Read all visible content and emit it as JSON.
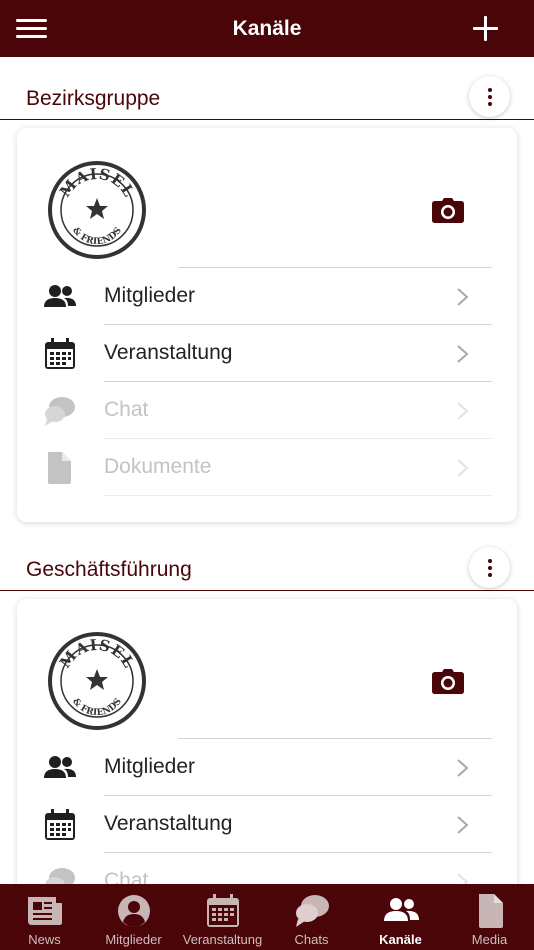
{
  "header": {
    "title": "Kanäle"
  },
  "sections": [
    {
      "title": "Bezirksgruppe",
      "logo_text": "MAISEL & FRIENDS",
      "items": [
        {
          "label": "Mitglieder",
          "icon": "users-icon",
          "enabled": true
        },
        {
          "label": "Veranstaltung",
          "icon": "calendar-icon",
          "enabled": true
        },
        {
          "label": "Chat",
          "icon": "chat-icon",
          "enabled": false
        },
        {
          "label": "Dokumente",
          "icon": "document-icon",
          "enabled": false
        }
      ]
    },
    {
      "title": "Geschäftsführung",
      "logo_text": "MAISEL & FRIENDS",
      "items": [
        {
          "label": "Mitglieder",
          "icon": "users-icon",
          "enabled": true
        },
        {
          "label": "Veranstaltung",
          "icon": "calendar-icon",
          "enabled": true
        },
        {
          "label": "Chat",
          "icon": "chat-icon",
          "enabled": false
        }
      ]
    }
  ],
  "tabbar": {
    "tabs": [
      {
        "label": "News",
        "icon": "news-icon",
        "active": false
      },
      {
        "label": "Mitglieder",
        "icon": "user-circle-icon",
        "active": false
      },
      {
        "label": "Veranstaltung",
        "icon": "calendar-icon",
        "active": false
      },
      {
        "label": "Chats",
        "icon": "chat-icon",
        "active": false
      },
      {
        "label": "Kanäle",
        "icon": "users-icon",
        "active": true
      },
      {
        "label": "Media",
        "icon": "document-icon",
        "active": false
      }
    ]
  },
  "colors": {
    "brand": "#4a0508",
    "icon_dark": "#1f1f1f",
    "disabled": "#c3c3c3",
    "tab_inactive_icon": "#c8b5b5",
    "tab_active_icon": "#ffffff"
  }
}
